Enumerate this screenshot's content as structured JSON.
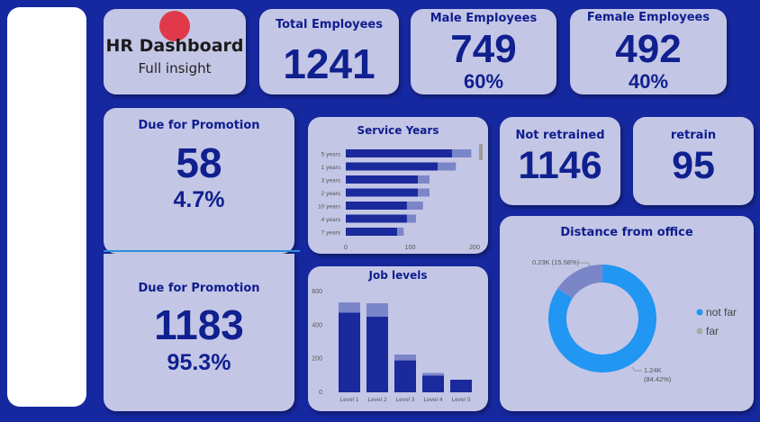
{
  "header": {
    "title": "HR Dashboard",
    "subtitle": "Full insight"
  },
  "kpis": {
    "total": {
      "label": "Total Employees",
      "value": "1241"
    },
    "male": {
      "label": "Male Employees",
      "value": "749",
      "pct": "60%"
    },
    "female": {
      "label": "Female Employees",
      "value": "492",
      "pct": "40%"
    },
    "promo_due": {
      "label": "Due for Promotion",
      "value": "58",
      "pct": "4.7%"
    },
    "promo_not": {
      "label": "Due for Promotion",
      "value": "1183",
      "pct": "95.3%"
    },
    "not_retrained": {
      "label": "Not retrained",
      "value": "1146"
    },
    "retrain": {
      "label": "retrain",
      "value": "95"
    }
  },
  "colors": {
    "background": "#1628a0",
    "card": "#c4c6e6",
    "dark_bar": "#1a2a9c",
    "light_bar": "#7b86c8",
    "not_far": "#2196f3",
    "far": "#7b86c8",
    "accent_dot": "#e03a4a"
  },
  "chart_data": [
    {
      "type": "bar",
      "orientation": "horizontal",
      "title": "Service Years",
      "categories": [
        "5 years",
        "1 years",
        "3 years",
        "2 years",
        "10 years",
        "4 years",
        "7 years"
      ],
      "series": [
        {
          "values": [
            165,
            143,
            112,
            112,
            95,
            95,
            80
          ]
        },
        {
          "values": [
            30,
            28,
            18,
            18,
            25,
            14,
            10
          ]
        }
      ],
      "xlim": [
        0,
        200
      ],
      "xticks": [
        0,
        100,
        200
      ]
    },
    {
      "type": "bar",
      "title": "Job levels",
      "categories": [
        "Level 1",
        "Level 2",
        "Level 3",
        "Level 4",
        "Level 5"
      ],
      "series": [
        {
          "values": [
            475,
            450,
            190,
            100,
            75
          ]
        },
        {
          "values": [
            60,
            80,
            35,
            15,
            0
          ]
        }
      ],
      "ylim": [
        0,
        600
      ],
      "yticks": [
        0,
        200,
        400,
        600
      ]
    },
    {
      "type": "pie",
      "title": "Distance from office",
      "categories": [
        "not far",
        "far"
      ],
      "values": [
        84.42,
        15.58
      ],
      "data_labels": [
        "1.24K (84.42%)",
        "0.23K (15.58%)"
      ],
      "legend": "right"
    }
  ],
  "donut_labels": {
    "far_label": "0.23K (15.58%)",
    "near_value": "1.24K",
    "near_pct": "(84.42%)"
  }
}
